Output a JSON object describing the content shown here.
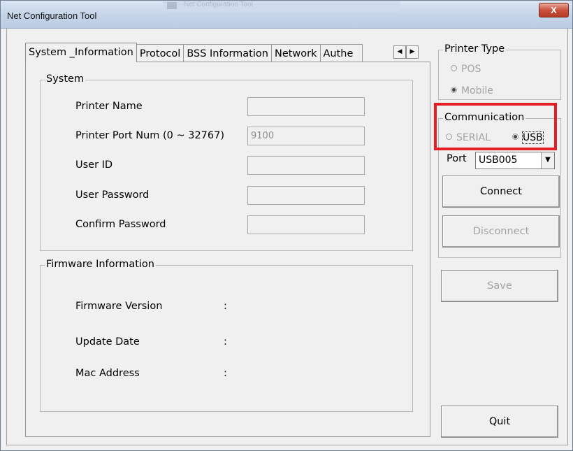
{
  "window": {
    "title": "Net Configuration Tool",
    "ghost_title": "Net Configuration Tool",
    "close_label": "X"
  },
  "tabs": [
    {
      "label": "System _Information",
      "active": true
    },
    {
      "label": "Protocol"
    },
    {
      "label": "BSS Information"
    },
    {
      "label": "Network"
    },
    {
      "label": "Authe"
    }
  ],
  "tab_scroll": {
    "left": "◀",
    "right": "▶"
  },
  "system": {
    "title": "System",
    "fields": [
      {
        "label": "Printer Name",
        "value": ""
      },
      {
        "label": "Printer Port Num (0 ~ 32767)",
        "value": "9100"
      },
      {
        "label": "User ID",
        "value": ""
      },
      {
        "label": "User Password",
        "value": ""
      },
      {
        "label": "Confirm Password",
        "value": ""
      }
    ]
  },
  "firmware": {
    "title": "Firmware Information",
    "rows": [
      {
        "label": "Firmware Version",
        "sep": ":"
      },
      {
        "label": "Update Date",
        "sep": ":"
      },
      {
        "label": "Mac Address",
        "sep": ":"
      }
    ]
  },
  "printer_type": {
    "title": "Printer Type",
    "options": [
      "POS",
      "Mobile"
    ],
    "selected": "Mobile"
  },
  "communication": {
    "title": "Communication",
    "options": [
      "SERIAL",
      "USB"
    ],
    "selected": "USB"
  },
  "port": {
    "label": "Port",
    "value": "USB005",
    "arrow": "▼"
  },
  "buttons": {
    "connect": "Connect",
    "disconnect": "Disconnect",
    "save": "Save",
    "quit": "Quit"
  },
  "colors": {
    "highlight": "#e61e25",
    "titlebar": "#c4d4e8",
    "close": "#c9513b"
  }
}
